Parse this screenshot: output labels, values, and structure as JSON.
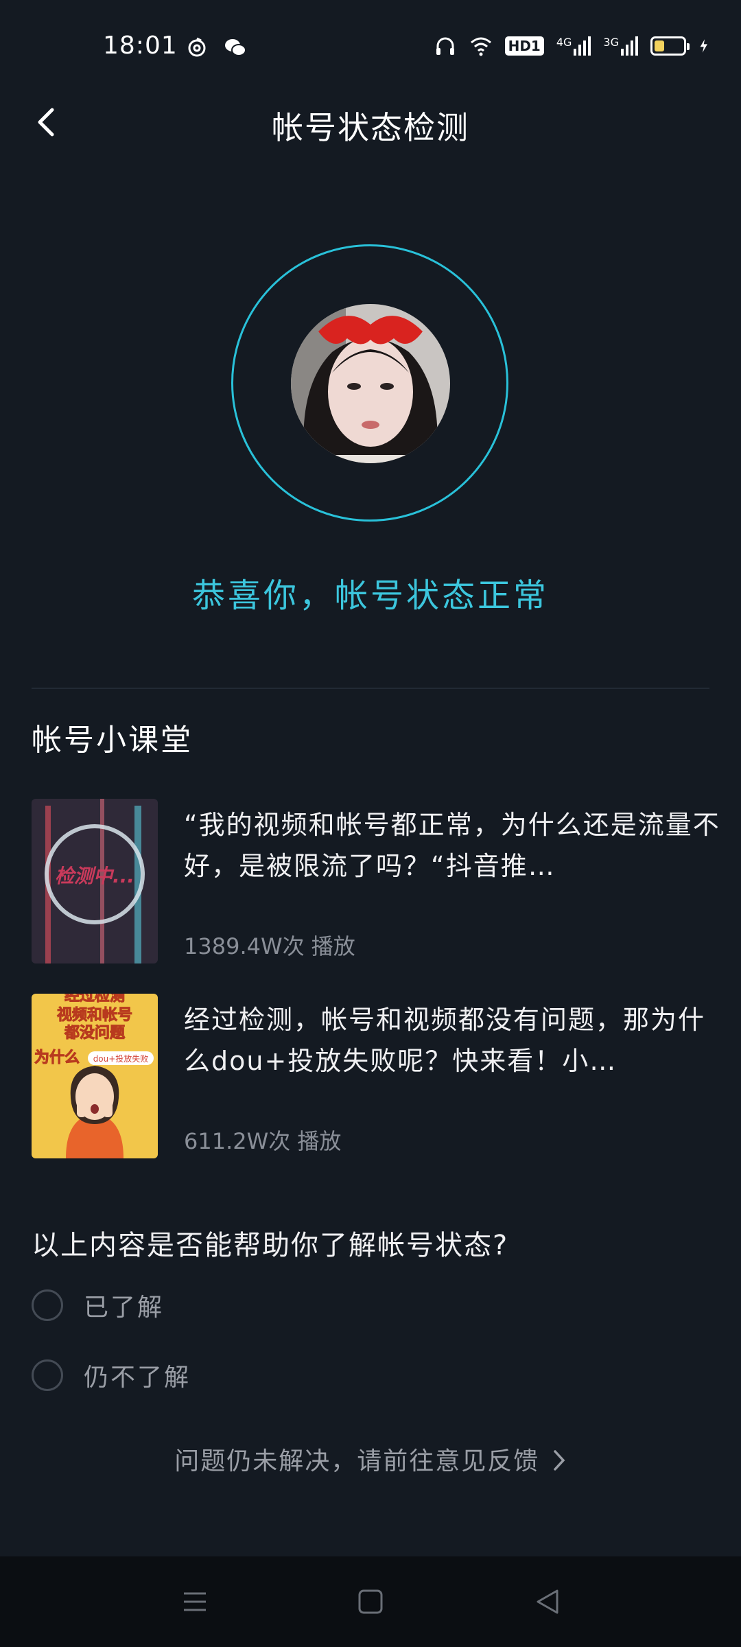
{
  "status_bar": {
    "time": "18:01",
    "left_icons": [
      "netease-music-icon",
      "wechat-icon"
    ],
    "right_icons": [
      "headphones-icon",
      "wifi-icon",
      "hd-icon",
      "signal-4g-icon",
      "signal-3g-icon",
      "battery-icon",
      "charging-icon"
    ],
    "hd_label": "HD1",
    "net_4g": "4G",
    "net_3g": "3G",
    "battery_level": 0.3,
    "colors": {
      "battery_fill": "#f4d35e"
    }
  },
  "header": {
    "title": "帐号状态检测",
    "back_icon": "chevron-left-icon"
  },
  "status": {
    "message": "恭喜你，帐号状态正常",
    "accent_color": "#29c1d9"
  },
  "lessons": {
    "section_title": "帐号小课堂",
    "items": [
      {
        "title": "“我的视频和帐号都正常，为什么还是流量不好，是被限流了吗？“抖音推…",
        "views": "1389.4W次 播放",
        "thumb_text": "检测中..."
      },
      {
        "title": "经过检测，帐号和视频都没有问题，那为什么dou+投放失败呢？快来看！小…",
        "views": "611.2W次 播放",
        "thumb_text_1": "经过检测",
        "thumb_text_2": "视频和帐号",
        "thumb_text_3": "都没问题",
        "thumb_text_4": "为什么",
        "thumb_badge": "dou+投放失败"
      }
    ]
  },
  "survey": {
    "question": "以上内容是否能帮助你了解帐号状态?",
    "options": [
      {
        "label": "已了解"
      },
      {
        "label": "仍不了解"
      }
    ]
  },
  "feedback": {
    "text": "问题仍未解决，请前往意见反馈"
  },
  "nav_bar": {
    "icons": [
      "menu-icon",
      "home-square-icon",
      "back-triangle-icon"
    ]
  }
}
